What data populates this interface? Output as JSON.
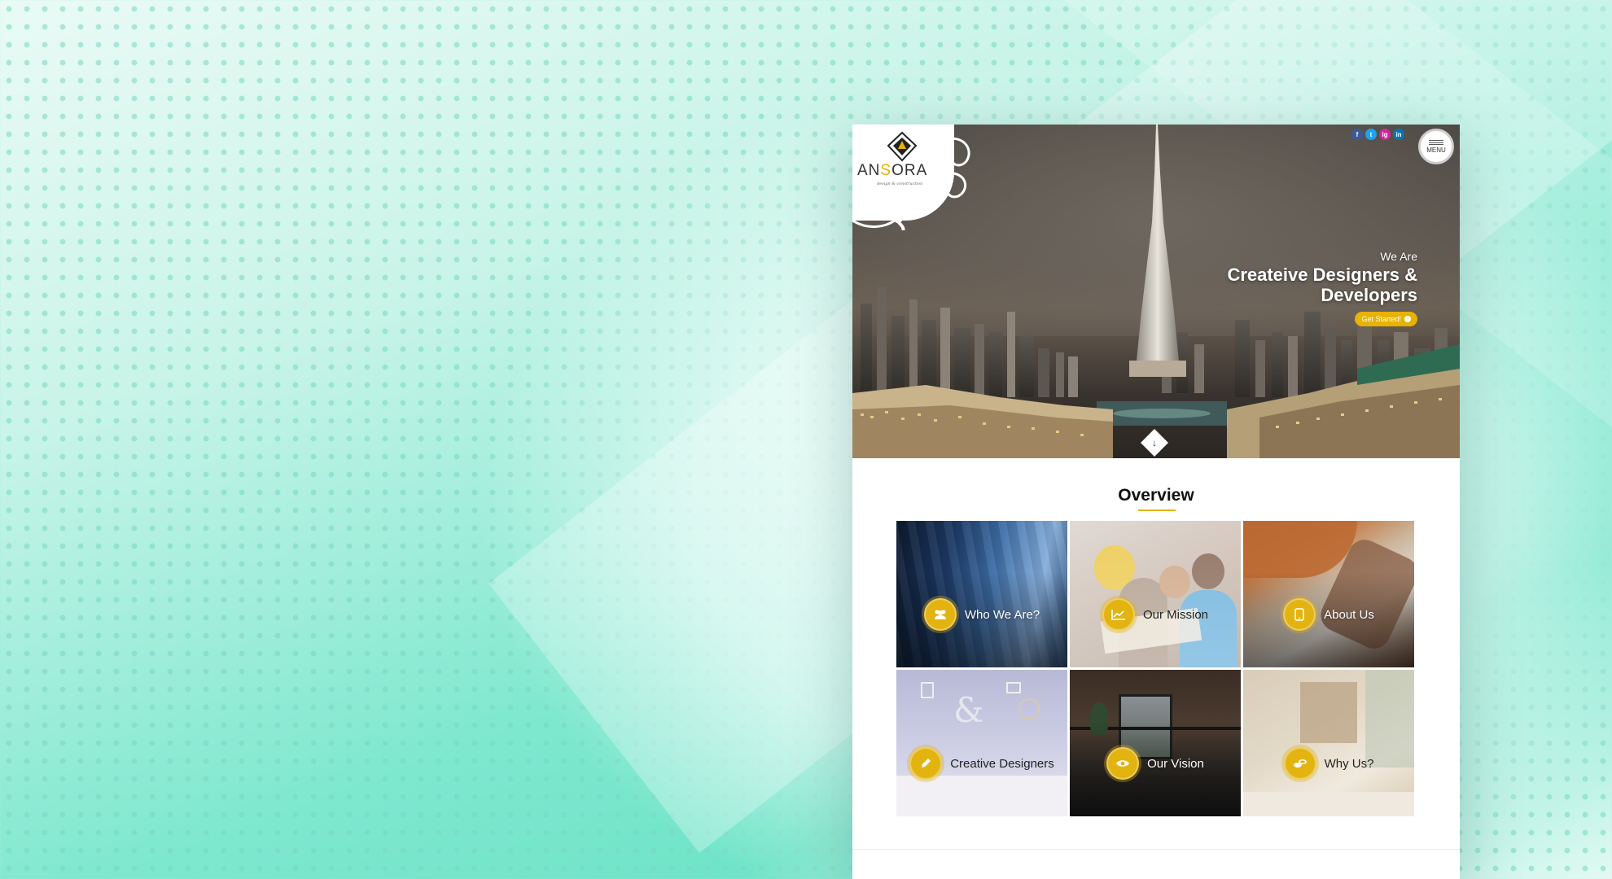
{
  "brand": {
    "name_part1": "AN",
    "name_accent": "S",
    "name_part2": "ORA",
    "tagline": "design & construction"
  },
  "header": {
    "socials": [
      {
        "label": "f",
        "name": "facebook",
        "color": "#3b5998"
      },
      {
        "label": "t",
        "name": "twitter",
        "color": "#1da1f2"
      },
      {
        "label": "ig",
        "name": "instagram",
        "color": "#d6249f"
      },
      {
        "label": "in",
        "name": "linkedin",
        "color": "#0077b5"
      }
    ],
    "menu_label": "MENU"
  },
  "hero": {
    "kicker": "We Are",
    "headline_line1": "Createive Designers &",
    "headline_line2": "Developers",
    "cta_label": "Get Started!"
  },
  "overview": {
    "title": "Overview",
    "tiles": [
      {
        "label": "Who We Are?",
        "icon": "users-icon"
      },
      {
        "label": "Our Mission",
        "icon": "chart-line-icon"
      },
      {
        "label": "About Us",
        "icon": "mobile-icon"
      },
      {
        "label": "Creative Designers",
        "icon": "pencil-icon"
      },
      {
        "label": "Our Vision",
        "icon": "eye-icon"
      },
      {
        "label": "Why Us?",
        "icon": "coins-icon"
      }
    ]
  },
  "colors": {
    "accent": "#e8b200",
    "background_mint": "#7fe8cf"
  }
}
